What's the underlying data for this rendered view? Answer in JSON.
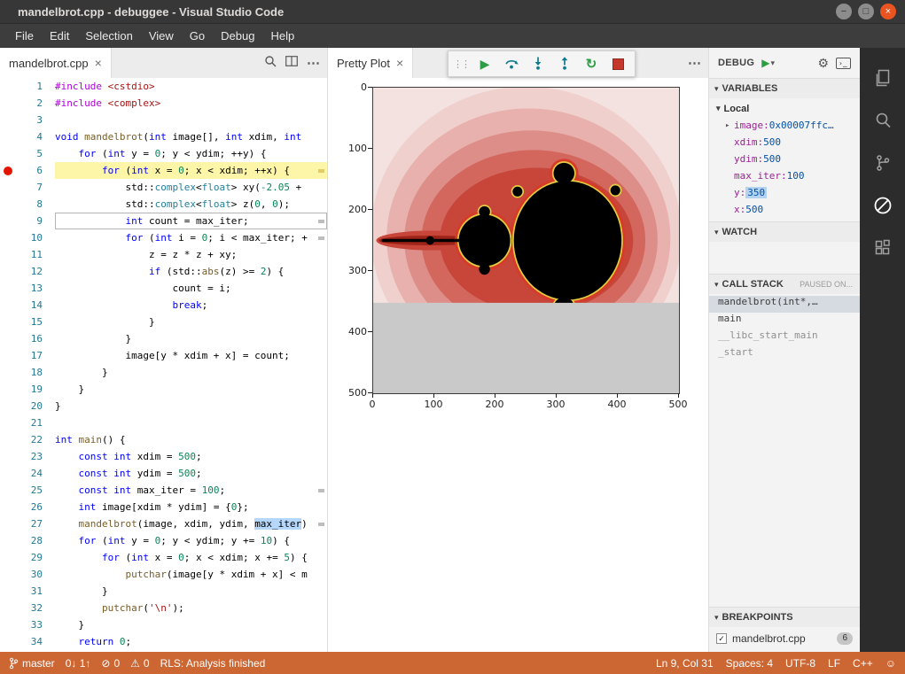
{
  "colors": {
    "statusbar": "#cc6633",
    "titlebar": "#373737",
    "menubar": "#3d3d3d",
    "activitybar": "#2c2c2c",
    "debugline": "#fdf6a8"
  },
  "icons": {
    "play": "▶",
    "restart": "↻",
    "close": "×",
    "more": "⋯",
    "gear": "⚙",
    "chevron_down": "▾",
    "chevron_right": "▸",
    "error": "⊘",
    "warning": "⚠",
    "smiley": "☺",
    "check": "✓",
    "drag": "⋮⋮",
    "console": "›_",
    "minimize": "−",
    "maximize": "□"
  },
  "titlebar": {
    "title": "mandelbrot.cpp - debuggee - Visual Studio Code"
  },
  "menubar": [
    "File",
    "Edit",
    "Selection",
    "View",
    "Go",
    "Debug",
    "Help"
  ],
  "code_editor": {
    "tab": "mandelbrot.cpp",
    "breakpoint_line": 6,
    "debug_line": 6,
    "cursor_line": 9,
    "overview_marks": [
      {
        "line": 6,
        "kind": "debug"
      },
      {
        "line": 9,
        "kind": "word"
      },
      {
        "line": 10,
        "kind": "word"
      },
      {
        "line": 25,
        "kind": "word"
      },
      {
        "line": 27,
        "kind": "word"
      }
    ],
    "lines": [
      {
        "t": [
          [
            "pp",
            "#include"
          ],
          [
            "str",
            " <cstdio>"
          ]
        ]
      },
      {
        "t": [
          [
            "pp",
            "#include"
          ],
          [
            "str",
            " <complex>"
          ]
        ]
      },
      {
        "t": []
      },
      {
        "t": [
          [
            "k",
            "void"
          ],
          [
            "p",
            " "
          ],
          [
            "fn",
            "mandelbrot"
          ],
          [
            "p",
            "("
          ],
          [
            "k",
            "int"
          ],
          [
            "p",
            " image[], "
          ],
          [
            "k",
            "int"
          ],
          [
            "p",
            " xdim, "
          ],
          [
            "k",
            "int"
          ],
          [
            "p",
            " "
          ]
        ]
      },
      {
        "t": [
          [
            "p",
            "    "
          ],
          [
            "k",
            "for"
          ],
          [
            "p",
            " ("
          ],
          [
            "k",
            "int"
          ],
          [
            "p",
            " y = "
          ],
          [
            "num",
            "0"
          ],
          [
            "p",
            "; y < ydim; ++y) {"
          ]
        ]
      },
      {
        "t": [
          [
            "p",
            "        "
          ],
          [
            "k",
            "for"
          ],
          [
            "p",
            " ("
          ],
          [
            "k",
            "int"
          ],
          [
            "p",
            " x = "
          ],
          [
            "num",
            "0"
          ],
          [
            "p",
            "; x < xdim; ++x) {"
          ]
        ]
      },
      {
        "t": [
          [
            "p",
            "            std::"
          ],
          [
            "ty",
            "complex"
          ],
          [
            "p",
            "<"
          ],
          [
            "ty",
            "float"
          ],
          [
            "p",
            "> xy("
          ],
          [
            "num",
            "-2.05"
          ],
          [
            "p",
            " + "
          ]
        ]
      },
      {
        "t": [
          [
            "p",
            "            std::"
          ],
          [
            "ty",
            "complex"
          ],
          [
            "p",
            "<"
          ],
          [
            "ty",
            "float"
          ],
          [
            "p",
            "> z("
          ],
          [
            "num",
            "0"
          ],
          [
            "p",
            ", "
          ],
          [
            "num",
            "0"
          ],
          [
            "p",
            ");"
          ]
        ]
      },
      {
        "t": [
          [
            "p",
            "            "
          ],
          [
            "k",
            "int"
          ],
          [
            "p",
            " count = max_iter;"
          ]
        ]
      },
      {
        "t": [
          [
            "p",
            "            "
          ],
          [
            "k",
            "for"
          ],
          [
            "p",
            " ("
          ],
          [
            "k",
            "int"
          ],
          [
            "p",
            " i = "
          ],
          [
            "num",
            "0"
          ],
          [
            "p",
            "; i < max_iter; +"
          ]
        ]
      },
      {
        "t": [
          [
            "p",
            "                z = z * z + xy;"
          ]
        ]
      },
      {
        "t": [
          [
            "p",
            "                "
          ],
          [
            "k",
            "if"
          ],
          [
            "p",
            " (std::"
          ],
          [
            "fn",
            "abs"
          ],
          [
            "p",
            "(z) >= "
          ],
          [
            "num",
            "2"
          ],
          [
            "p",
            ") {"
          ]
        ]
      },
      {
        "t": [
          [
            "p",
            "                    count = i;"
          ]
        ]
      },
      {
        "t": [
          [
            "p",
            "                    "
          ],
          [
            "k",
            "break"
          ],
          [
            "p",
            ";"
          ]
        ]
      },
      {
        "t": [
          [
            "p",
            "                }"
          ]
        ]
      },
      {
        "t": [
          [
            "p",
            "            }"
          ]
        ]
      },
      {
        "t": [
          [
            "p",
            "            image[y * xdim + x] = count;"
          ]
        ]
      },
      {
        "t": [
          [
            "p",
            "        }"
          ]
        ]
      },
      {
        "t": [
          [
            "p",
            "    }"
          ]
        ]
      },
      {
        "t": [
          [
            "p",
            "}"
          ]
        ]
      },
      {
        "t": []
      },
      {
        "t": [
          [
            "k",
            "int"
          ],
          [
            "p",
            " "
          ],
          [
            "fn",
            "main"
          ],
          [
            "p",
            "() {"
          ]
        ]
      },
      {
        "t": [
          [
            "p",
            "    "
          ],
          [
            "k",
            "const"
          ],
          [
            "p",
            " "
          ],
          [
            "k",
            "int"
          ],
          [
            "p",
            " xdim = "
          ],
          [
            "num",
            "500"
          ],
          [
            "p",
            ";"
          ]
        ]
      },
      {
        "t": [
          [
            "p",
            "    "
          ],
          [
            "k",
            "const"
          ],
          [
            "p",
            " "
          ],
          [
            "k",
            "int"
          ],
          [
            "p",
            " ydim = "
          ],
          [
            "num",
            "500"
          ],
          [
            "p",
            ";"
          ]
        ]
      },
      {
        "t": [
          [
            "p",
            "    "
          ],
          [
            "k",
            "const"
          ],
          [
            "p",
            " "
          ],
          [
            "k",
            "int"
          ],
          [
            "p",
            " max_iter = "
          ],
          [
            "num",
            "100"
          ],
          [
            "p",
            ";"
          ]
        ]
      },
      {
        "t": [
          [
            "p",
            "    "
          ],
          [
            "k",
            "int"
          ],
          [
            "p",
            " image[xdim * ydim] = {"
          ],
          [
            "num",
            "0"
          ],
          [
            "p",
            "};"
          ]
        ]
      },
      {
        "t": [
          [
            "p",
            "    "
          ],
          [
            "fn",
            "mandelbrot"
          ],
          [
            "p",
            "(image, xdim, ydim, "
          ],
          [
            "ph",
            "max_iter"
          ],
          [
            "p",
            ")"
          ]
        ]
      },
      {
        "t": [
          [
            "p",
            "    "
          ],
          [
            "k",
            "for"
          ],
          [
            "p",
            " ("
          ],
          [
            "k",
            "int"
          ],
          [
            "p",
            " y = "
          ],
          [
            "num",
            "0"
          ],
          [
            "p",
            "; y < ydim; y += "
          ],
          [
            "num",
            "10"
          ],
          [
            "p",
            ") {"
          ]
        ]
      },
      {
        "t": [
          [
            "p",
            "        "
          ],
          [
            "k",
            "for"
          ],
          [
            "p",
            " ("
          ],
          [
            "k",
            "int"
          ],
          [
            "p",
            " x = "
          ],
          [
            "num",
            "0"
          ],
          [
            "p",
            "; x < xdim; x += "
          ],
          [
            "num",
            "5"
          ],
          [
            "p",
            ") {"
          ]
        ]
      },
      {
        "t": [
          [
            "p",
            "            "
          ],
          [
            "fn",
            "putchar"
          ],
          [
            "p",
            "(image[y * xdim + x] < m"
          ]
        ]
      },
      {
        "t": [
          [
            "p",
            "        }"
          ]
        ]
      },
      {
        "t": [
          [
            "p",
            "        "
          ],
          [
            "fn",
            "putchar"
          ],
          [
            "p",
            "("
          ],
          [
            "str",
            "'\\n'"
          ],
          [
            "p",
            ");"
          ]
        ]
      },
      {
        "t": [
          [
            "p",
            "    }"
          ]
        ]
      },
      {
        "t": [
          [
            "p",
            "    "
          ],
          [
            "k",
            "return"
          ],
          [
            "p",
            " "
          ],
          [
            "num",
            "0"
          ],
          [
            "p",
            ";"
          ]
        ]
      }
    ]
  },
  "plot_pane": {
    "tab": "Pretty Plot",
    "x_ticks": [
      "0",
      "100",
      "200",
      "300",
      "400",
      "500"
    ],
    "y_ticks": [
      "0",
      "100",
      "200",
      "300",
      "400",
      "500"
    ]
  },
  "debug_toolbar": {
    "buttons": [
      "continue",
      "step-over",
      "step-into",
      "step-out",
      "restart",
      "stop"
    ]
  },
  "sidebar": {
    "title": "DEBUG",
    "variables": {
      "header": "VARIABLES",
      "scope": "Local",
      "items": [
        {
          "name": "image",
          "value": "0x00007ffc…",
          "expandable": true
        },
        {
          "name": "xdim",
          "value": "500"
        },
        {
          "name": "ydim",
          "value": "500"
        },
        {
          "name": "max_iter",
          "value": "100"
        },
        {
          "name": "y",
          "value": "350",
          "changed": true
        },
        {
          "name": "x",
          "value": "500"
        }
      ]
    },
    "watch": {
      "header": "WATCH"
    },
    "call_stack": {
      "header": "CALL STACK",
      "status": "PAUSED ON...",
      "frames": [
        {
          "label": "mandelbrot(int*,…",
          "selected": true
        },
        {
          "label": "main"
        },
        {
          "label": "__libc_start_main",
          "dim": true
        },
        {
          "label": "_start",
          "dim": true
        }
      ]
    },
    "breakpoints": {
      "header": "BREAKPOINTS",
      "items": [
        {
          "file": "mandelbrot.cpp",
          "line": "6",
          "checked": true
        }
      ]
    }
  },
  "statusbar": {
    "left": [
      {
        "name": "branch",
        "icon": "branch",
        "label": "master"
      },
      {
        "name": "sync",
        "label": "0↓ 1↑"
      },
      {
        "name": "errors",
        "icon": "error",
        "label": "0"
      },
      {
        "name": "warnings",
        "icon": "warning",
        "label": "0"
      },
      {
        "name": "rls-status",
        "label": "RLS: Analysis finished"
      }
    ],
    "right": [
      {
        "name": "cursor-position",
        "label": "Ln 9, Col 31"
      },
      {
        "name": "indentation",
        "label": "Spaces: 4"
      },
      {
        "name": "encoding",
        "label": "UTF-8"
      },
      {
        "name": "eol",
        "label": "LF"
      },
      {
        "name": "language-mode",
        "label": "C++"
      },
      {
        "name": "feedback",
        "icon": "smiley"
      }
    ]
  }
}
